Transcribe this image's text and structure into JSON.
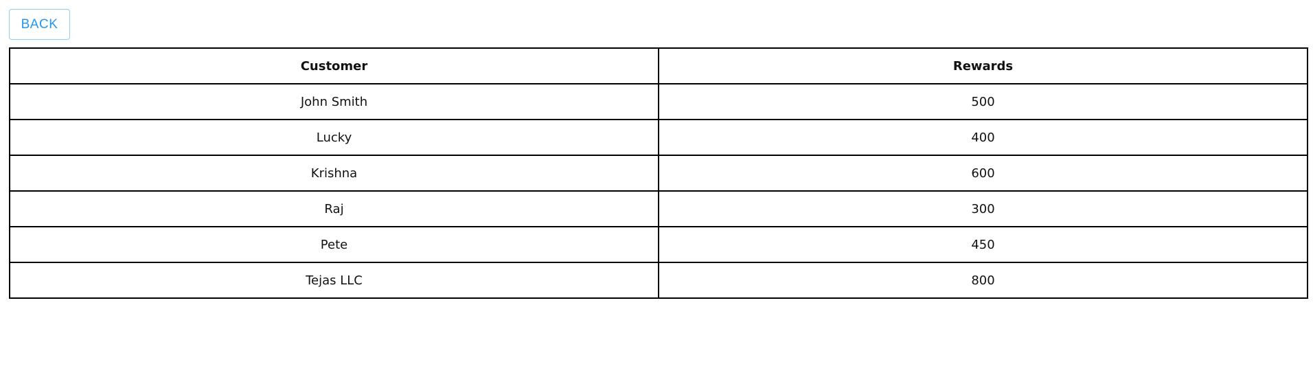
{
  "toolbar": {
    "back_label": "BACK"
  },
  "table": {
    "headers": {
      "customer": "Customer",
      "rewards": "Rewards"
    },
    "rows": [
      {
        "customer": "John Smith",
        "rewards": "500"
      },
      {
        "customer": "Lucky",
        "rewards": "400"
      },
      {
        "customer": "Krishna",
        "rewards": "600"
      },
      {
        "customer": "Raj",
        "rewards": "300"
      },
      {
        "customer": "Pete",
        "rewards": "450"
      },
      {
        "customer": "Tejas LLC",
        "rewards": "800"
      }
    ]
  },
  "colors": {
    "accent": "#2196f3",
    "button_border": "#90caf9",
    "table_border": "#000000"
  }
}
